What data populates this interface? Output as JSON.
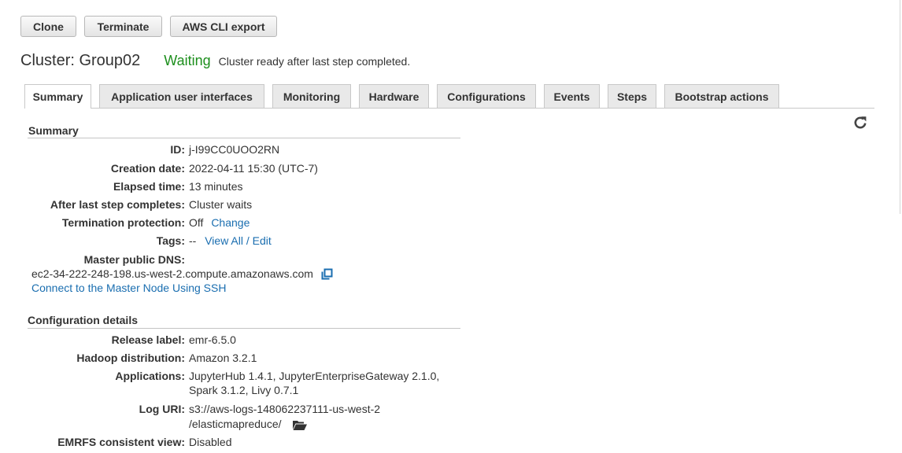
{
  "toolbar": {
    "clone_label": "Clone",
    "terminate_label": "Terminate",
    "cli_export_label": "AWS CLI export"
  },
  "cluster": {
    "title": "Cluster: Group02",
    "status": "Waiting",
    "status_description": "Cluster ready after last step completed.",
    "status_color": "#1d8f1d"
  },
  "tabs": [
    {
      "label": "Summary",
      "active": true
    },
    {
      "label": "Application user interfaces"
    },
    {
      "label": "Monitoring"
    },
    {
      "label": "Hardware"
    },
    {
      "label": "Configurations"
    },
    {
      "label": "Events"
    },
    {
      "label": "Steps"
    },
    {
      "label": "Bootstrap actions"
    }
  ],
  "icons": {
    "refresh": "refresh-icon",
    "copy": "copy-icon",
    "folder": "folder-open-icon"
  },
  "summary": {
    "heading": "Summary",
    "id_label": "ID:",
    "id_value": "j-I99CC0UOO2RN",
    "creation_label": "Creation date:",
    "creation_value": "2022-04-11 15:30 (UTC-7)",
    "elapsed_label": "Elapsed time:",
    "elapsed_value": "13 minutes",
    "after_step_label": "After last step completes:",
    "after_step_value": "Cluster waits",
    "termination_label": "Termination protection:",
    "termination_value": "Off",
    "termination_link": "Change",
    "tags_label": "Tags:",
    "tags_value": "--",
    "tags_link": "View All / Edit",
    "dns_label": "Master public DNS:",
    "dns_value": "ec2-34-222-248-198.us-west-2.compute.amazonaws.com",
    "ssh_link": "Connect to the Master Node Using SSH"
  },
  "config": {
    "heading": "Configuration details",
    "release_label": "Release label:",
    "release_value": "emr-6.5.0",
    "hadoop_label": "Hadoop distribution:",
    "hadoop_value": "Amazon 3.2.1",
    "apps_label": "Applications:",
    "apps_line1": "JupyterHub 1.4.1, JupyterEnterpriseGateway 2.1.0,",
    "apps_line2": "Spark 3.1.2, Livy 0.7.1",
    "log_label": "Log URI:",
    "log_line1": "s3://aws-logs-148062237111-us-west-2",
    "log_line2": "/elasticmapreduce/",
    "emrfs_label": "EMRFS consistent view:",
    "emrfs_value": "Disabled"
  },
  "colors": {
    "link": "#1a6eb0",
    "tab_inactive": "#e9e9e9"
  }
}
